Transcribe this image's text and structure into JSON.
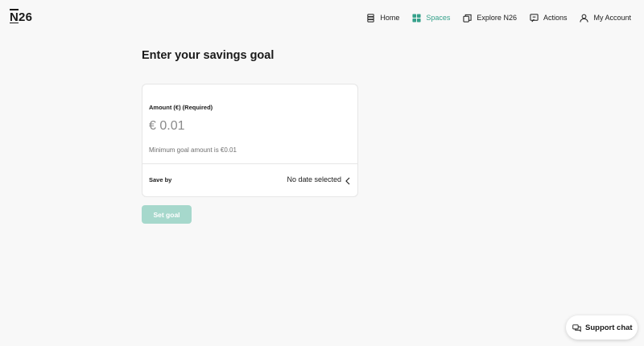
{
  "brand": {
    "logo_text": "N26"
  },
  "nav": {
    "items": [
      {
        "label": "Home",
        "icon": "home-icon"
      },
      {
        "label": "Spaces",
        "icon": "spaces-icon",
        "active": true
      },
      {
        "label": "Explore N26",
        "icon": "explore-icon"
      },
      {
        "label": "Actions",
        "icon": "actions-icon"
      },
      {
        "label": "My Account",
        "icon": "account-icon"
      }
    ]
  },
  "main": {
    "title": "Enter your savings goal",
    "amount": {
      "label": "Amount (€) (Required)",
      "placeholder": "€ 0.01",
      "value": "",
      "hint": "Minimum goal amount is €0.01"
    },
    "save_by": {
      "label": "Save by",
      "value": "No date selected"
    },
    "submit_label": "Set goal"
  },
  "support": {
    "label": "Support chat",
    "icon": "chat-icon"
  },
  "colors": {
    "accent": "#36a18b",
    "button_disabled": "#a6d8cc",
    "background": "#f8f8f8"
  }
}
